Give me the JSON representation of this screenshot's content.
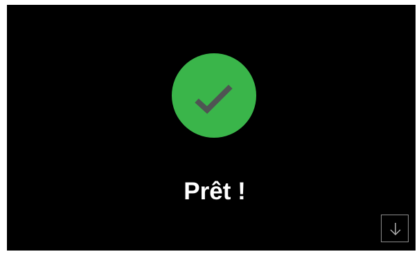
{
  "status": {
    "title": "Prêt !",
    "state": "ready",
    "icon": "checkmark-icon",
    "colors": {
      "success": "#3ab54a",
      "check": "#4f5453",
      "background": "#000000",
      "text": "#ffffff"
    }
  },
  "controls": {
    "scroll_down_icon": "arrow-down-icon"
  }
}
